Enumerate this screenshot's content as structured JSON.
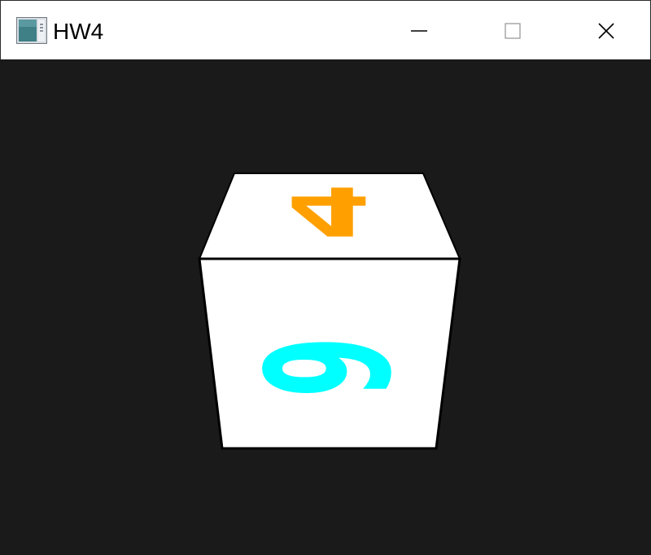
{
  "window": {
    "title": "HW4"
  },
  "titlebar": {
    "buttons": [
      "minimize",
      "maximize",
      "close"
    ]
  },
  "icons": {
    "app": "app-window-icon",
    "minimize": "minimize-icon",
    "maximize": "maximize-icon",
    "close": "close-icon"
  },
  "viewport": {
    "background": "#1a1a1a",
    "cube": {
      "face_color": "#ffffff",
      "edge_color": "#000000",
      "top_face_digit": "4",
      "top_face_color": "#ffa000",
      "front_face_digit": "9",
      "front_face_color": "#00ffff"
    }
  }
}
